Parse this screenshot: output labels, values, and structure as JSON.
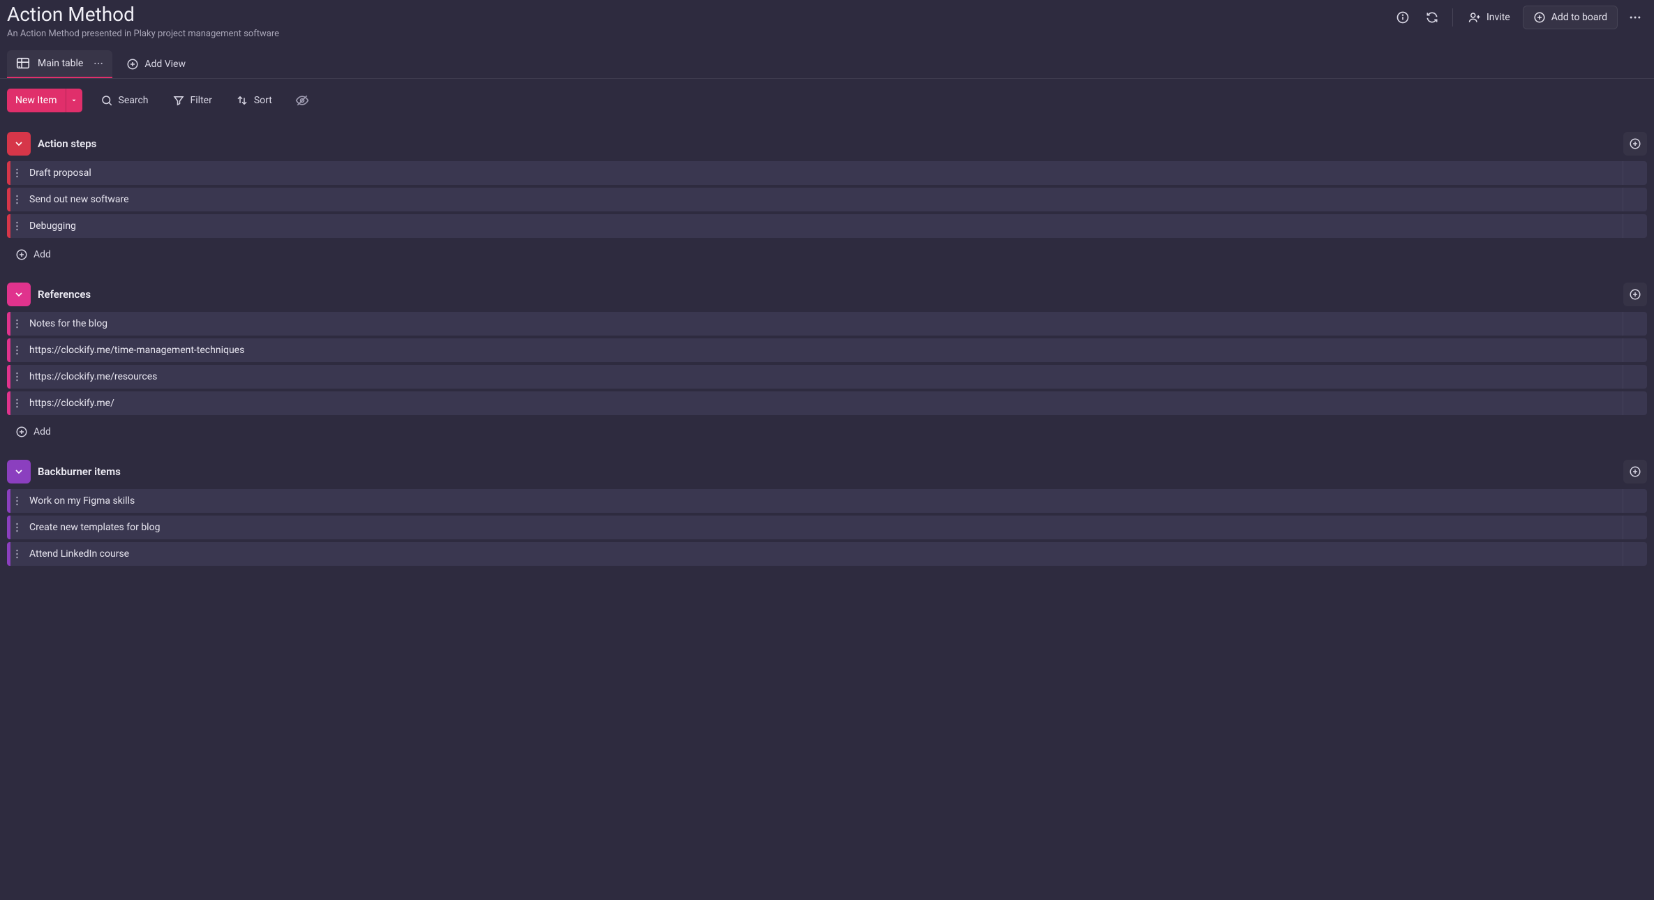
{
  "header": {
    "title": "Action Method",
    "subtitle": "An Action Method presented in Plaky project management software",
    "invite_label": "Invite",
    "add_to_board_label": "Add to board"
  },
  "views": {
    "main_tab_label": "Main table",
    "add_view_label": "Add View"
  },
  "toolbar": {
    "new_item_label": "New Item",
    "search_label": "Search",
    "filter_label": "Filter",
    "sort_label": "Sort"
  },
  "groups": [
    {
      "id": "action-steps",
      "title": "Action steps",
      "color_class": "group--red",
      "add_label": "Add",
      "items": [
        {
          "name": "Draft proposal"
        },
        {
          "name": "Send out new software"
        },
        {
          "name": "Debugging"
        }
      ]
    },
    {
      "id": "references",
      "title": "References",
      "color_class": "group--pink",
      "add_label": "Add",
      "items": [
        {
          "name": "Notes for the blog"
        },
        {
          "name": "https://clockify.me/time-management-techniques"
        },
        {
          "name": "https://clockify.me/resources"
        },
        {
          "name": "https://clockify.me/"
        }
      ]
    },
    {
      "id": "backburner",
      "title": "Backburner items",
      "color_class": "group--purple",
      "add_label": "Add",
      "items": [
        {
          "name": "Work on my Figma skills"
        },
        {
          "name": "Create new templates for blog"
        },
        {
          "name": "Attend LinkedIn course"
        }
      ]
    }
  ]
}
